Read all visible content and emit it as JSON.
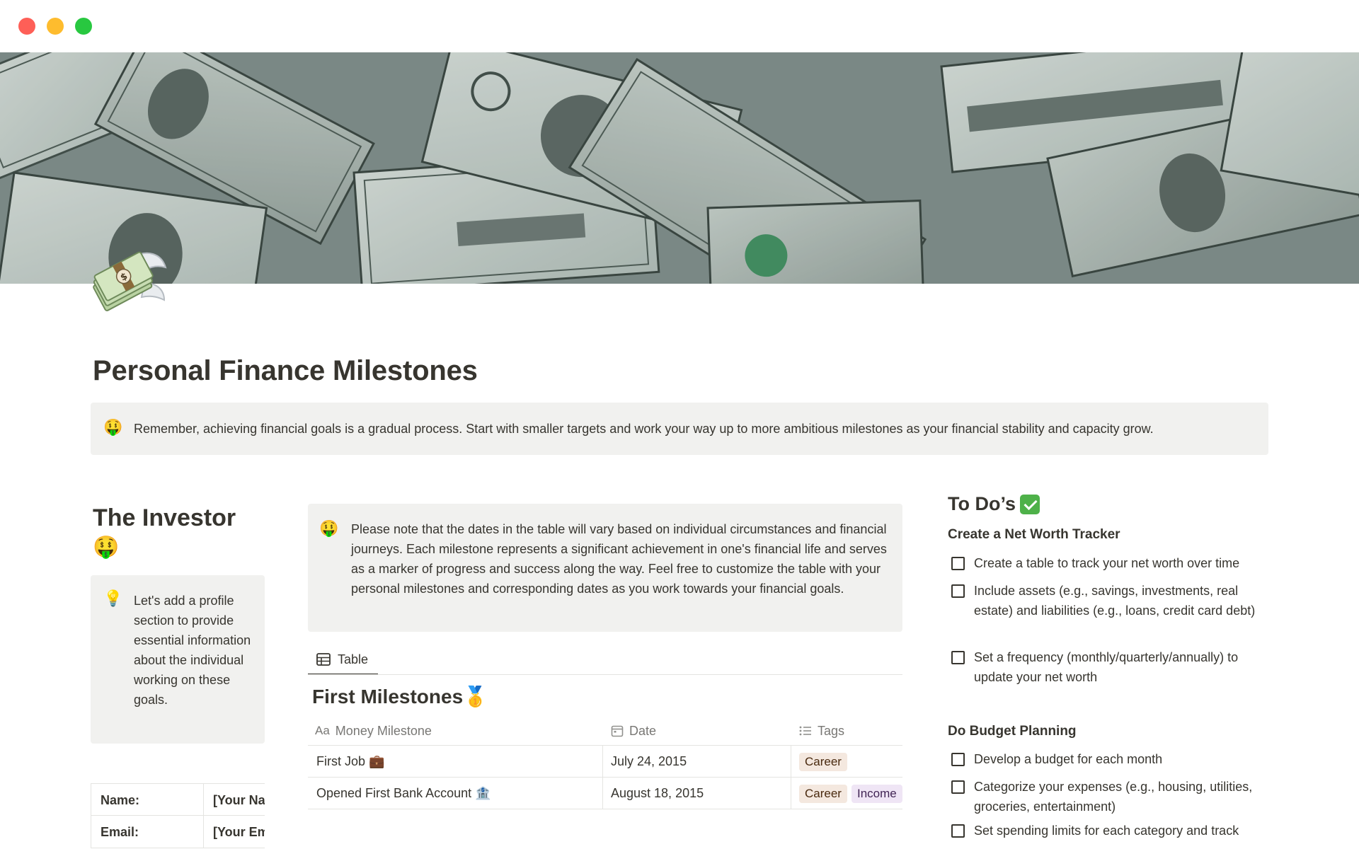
{
  "window": {
    "buttons": [
      "close",
      "minimize",
      "zoom"
    ]
  },
  "page": {
    "title": "Personal Finance Milestones",
    "icon": "money-with-wings-icon"
  },
  "callout_top": {
    "icon": "money-mouth-face-icon",
    "text": "Remember, achieving financial goals is a gradual process. Start with smaller targets and work your way up to more ambitious milestones as your financial stability and capacity grow."
  },
  "investor": {
    "title": "The Investor",
    "emoji": "🤑",
    "callout_icon": "lightbulb-icon",
    "callout_text": "Let's add a profile section to provide essential information about the individual working on these goals.",
    "profile": [
      {
        "label": "Name:",
        "value": "[Your Name]"
      },
      {
        "label": "Email:",
        "value": "[Your Email]"
      }
    ]
  },
  "milestones": {
    "callout_icon": "money-mouth-face-icon",
    "callout_text": "Please note that the dates in the table will vary based on individual circumstances and financial journeys. Each milestone represents a significant achievement in one's financial life and serves as a marker of progress and success along the way. Feel free to customize the table with your personal milestones and corresponding dates as you work towards your financial goals.",
    "view_tab": "Table",
    "db_title": "First Milestones",
    "db_title_emoji": "🥇",
    "columns": [
      {
        "icon": "Aa",
        "label": "Money Milestone"
      },
      {
        "icon": "calendar-icon",
        "label": "Date"
      },
      {
        "icon": "list-icon",
        "label": "Tags"
      }
    ],
    "rows": [
      {
        "name": "First Job 💼",
        "date": "July 24, 2015",
        "tags": [
          "Career"
        ]
      },
      {
        "name": "Opened First Bank Account 🏦",
        "date": "August 18, 2015",
        "tags": [
          "Career",
          "Income"
        ]
      }
    ]
  },
  "todos": {
    "title": "To Do’s",
    "title_icon": "check-mark-button-icon",
    "sections": [
      {
        "title": "Create a Net Worth Tracker",
        "items": [
          "Create a table to track your net worth over time",
          "Include assets (e.g., savings, investments, real estate) and liabilities (e.g., loans, credit card debt)",
          "Set a frequency (monthly/quarterly/annually) to update your net worth"
        ]
      },
      {
        "title": "Do Budget Planning",
        "items": [
          "Develop a budget for each month",
          "Categorize your expenses (e.g., housing, utilities, groceries, entertainment)",
          "Set spending limits for each category and track"
        ]
      }
    ]
  }
}
